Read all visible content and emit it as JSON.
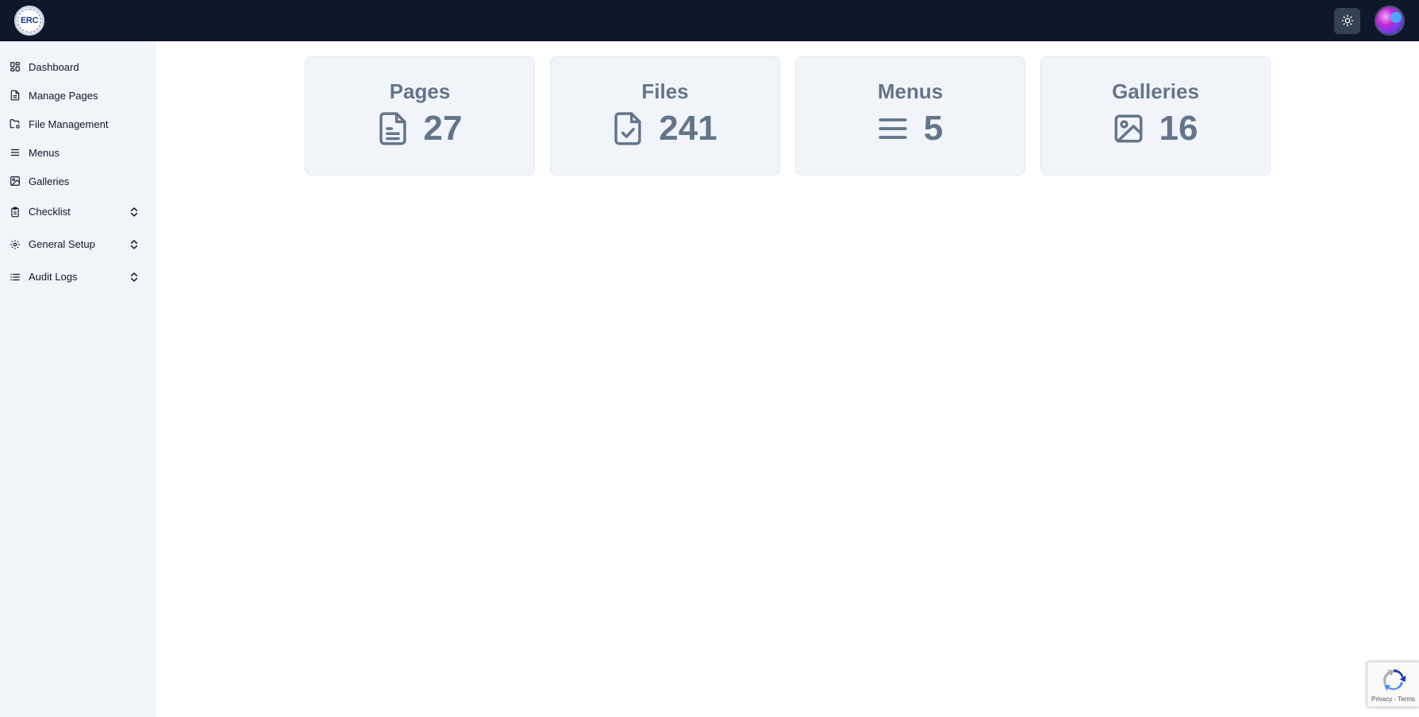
{
  "header": {
    "logo_text": "ERC",
    "theme_icon": "sun-icon",
    "avatar_icon": "user-avatar"
  },
  "sidebar": {
    "items": [
      {
        "label": "Dashboard",
        "icon": "layout-grid-icon"
      },
      {
        "label": "Manage Pages",
        "icon": "file-text-icon"
      },
      {
        "label": "File Management",
        "icon": "folder-cog-icon"
      },
      {
        "label": "Menus",
        "icon": "menu-lines-icon"
      },
      {
        "label": "Galleries",
        "icon": "image-icon"
      },
      {
        "label": "Checklist",
        "icon": "clipboard-icon",
        "expandable": true
      },
      {
        "label": "General Setup",
        "icon": "gear-icon",
        "expandable": true
      },
      {
        "label": "Audit Logs",
        "icon": "list-icon",
        "expandable": true
      }
    ]
  },
  "stats": [
    {
      "title": "Pages",
      "value": "27",
      "icon": "file-text-icon"
    },
    {
      "title": "Files",
      "value": "241",
      "icon": "file-check-icon"
    },
    {
      "title": "Menus",
      "value": "5",
      "icon": "menu-lines-icon"
    },
    {
      "title": "Galleries",
      "value": "16",
      "icon": "image-icon"
    }
  ],
  "recaptcha": {
    "text": "Privacy - Terms"
  },
  "colors": {
    "topbar": "#0f172a",
    "sidebar": "#f1f5f9",
    "card_bg": "#f1f5f9",
    "card_text": "#64748b"
  }
}
